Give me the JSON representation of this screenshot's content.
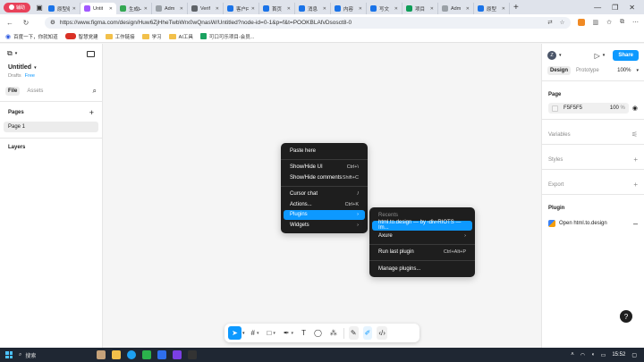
{
  "browser": {
    "profile_label": "辅助",
    "tabs": [
      {
        "label": "原型组",
        "color": "#1a73e8",
        "active": false
      },
      {
        "label": "Untit",
        "color": "#a259ff",
        "active": true
      },
      {
        "label": "生成H",
        "color": "#34a853",
        "active": false
      },
      {
        "label": "Adm",
        "color": "#9aa0a6",
        "active": false
      },
      {
        "label": "Verif",
        "color": "#5f6368",
        "active": false
      },
      {
        "label": "客户F",
        "color": "#1a73e8",
        "active": false
      },
      {
        "label": "首页",
        "color": "#1a73e8",
        "active": false
      },
      {
        "label": "消息",
        "color": "#1a73e8",
        "active": false
      },
      {
        "label": "内容",
        "color": "#1a73e8",
        "active": false
      },
      {
        "label": "写文",
        "color": "#1a73e8",
        "active": false
      },
      {
        "label": "项目",
        "color": "#0f9d58",
        "active": false
      },
      {
        "label": "Adm",
        "color": "#9aa0a6",
        "active": false
      },
      {
        "label": "原型",
        "color": "#1a73e8",
        "active": false
      }
    ],
    "url": "https://www.figma.com/design/Huw6ZjHheTwbWrx0wQnasW/Untitled?node-id=0-1&p=f&t=POOKBLAfvDsosct8-0",
    "bookmarks": [
      "百度一下，你就知道",
      "智慧党建",
      "工作链接",
      "学习",
      "AI工具",
      "可口可乐项目-会员..."
    ]
  },
  "figma": {
    "file_name": "Untitled",
    "team": "Drafts",
    "plan": "Free",
    "left_tabs": {
      "file": "File",
      "assets": "Assets"
    },
    "pages_title": "Pages",
    "page_item": "Page 1",
    "layers_title": "Layers",
    "context_menu": [
      {
        "label": "Paste here",
        "shortcut": ""
      },
      {
        "label": "Show/Hide UI",
        "shortcut": "Ctrl+\\"
      },
      {
        "label": "Show/Hide comments",
        "shortcut": "Shift+C"
      },
      {
        "label": "Cursor chat",
        "shortcut": "/"
      },
      {
        "label": "Actions...",
        "shortcut": "Ctrl+K"
      },
      {
        "label": "Plugins",
        "shortcut": "›"
      },
      {
        "label": "Widgets",
        "shortcut": "›"
      }
    ],
    "plugins_submenu": {
      "heading": "Recents",
      "items": [
        {
          "label": "html.to.design — by ‹div›RIOTS — Im...",
          "shortcut": ""
        },
        {
          "label": "Axure",
          "shortcut": "›"
        },
        {
          "label": "Run last plugin",
          "shortcut": "Ctrl+Alt+P"
        },
        {
          "label": "Manage plugins...",
          "shortcut": ""
        }
      ]
    },
    "right": {
      "avatar": "Z",
      "share": "Share",
      "tab_design": "Design",
      "tab_prototype": "Prototype",
      "zoom": "100%",
      "page_title": "Page",
      "page_color": "F5F5F5",
      "page_opacity": "100",
      "opacity_unit": "%",
      "variables": "Variables",
      "styles": "Styles",
      "export": "Export",
      "plugin_title": "Plugin",
      "plugin_name": "Open html.to.design"
    }
  },
  "taskbar": {
    "search": "搜索",
    "time": "15:52"
  }
}
